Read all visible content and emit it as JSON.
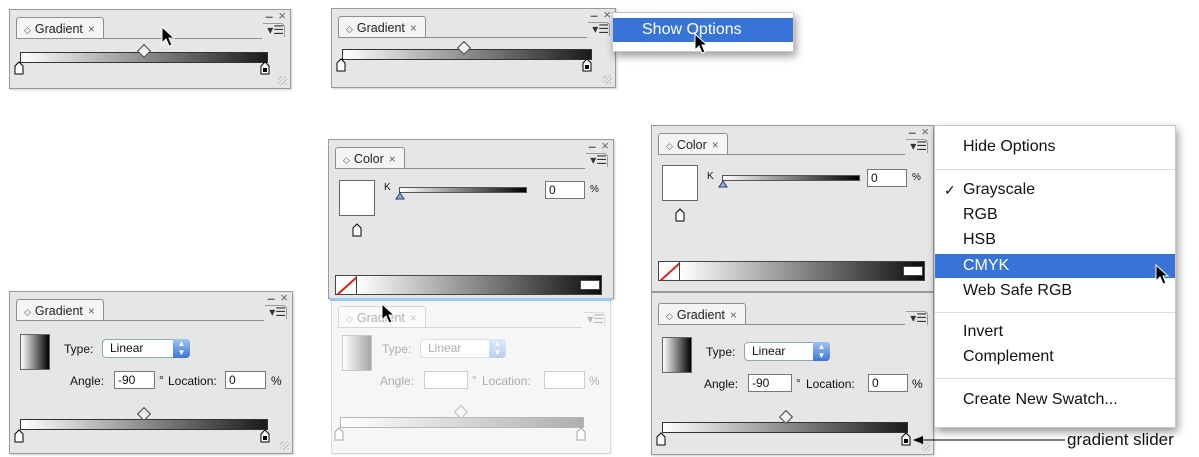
{
  "panels": {
    "gradient_tab_label": "Gradient",
    "color_tab_label": "Color",
    "close_glyph": "×",
    "minimize_glyph": "–",
    "menu_glyph": "▾☰",
    "tab_arrows_glyph": "◇"
  },
  "gradient_options": {
    "type_label": "Type:",
    "type_value": "Linear",
    "angle_label": "Angle:",
    "angle_value": "-90",
    "degree_symbol": "°",
    "location_label": "Location:",
    "location_value": "0",
    "percent": "%"
  },
  "color_panel": {
    "k_label": "K",
    "k_value": "0",
    "percent": "%"
  },
  "flyout_top": {
    "item": "Show Options"
  },
  "flyout_right": {
    "items": [
      "Hide Options",
      "Grayscale",
      "RGB",
      "HSB",
      "CMYK",
      "Web Safe RGB",
      "Invert",
      "Complement",
      "Create New Swatch..."
    ],
    "checked_item": "Grayscale",
    "highlighted_item": "CMYK",
    "check_glyph": "✓"
  },
  "callout": {
    "text": "gradient slider"
  },
  "colors": {
    "panel_bg": "#e6e6e6",
    "menu_highlight": "#3874d8",
    "callout_line": "#000000"
  }
}
